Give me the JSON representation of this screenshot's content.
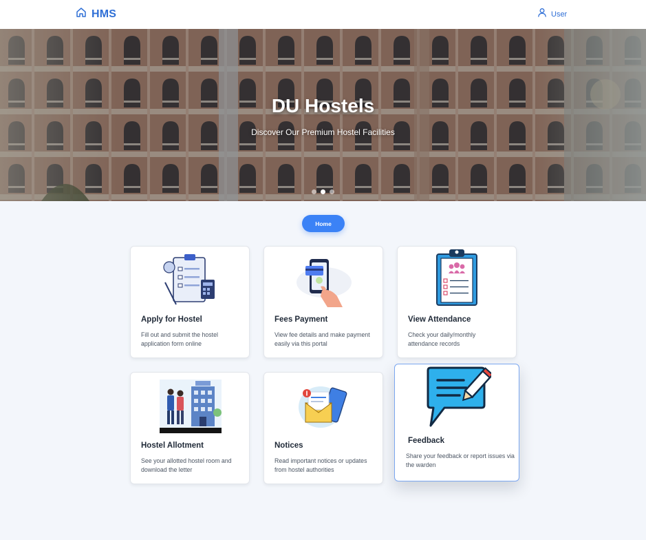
{
  "navbar": {
    "brand": "HMS",
    "brand_icon": "home-icon",
    "user_label": "User",
    "user_icon": "user-icon",
    "accent_color": "#2f6fd6"
  },
  "hero": {
    "title": "DU Hostels",
    "subtitle": "Discover Our Premium Hostel Facilities",
    "slide_count": 3,
    "active_slide": 2
  },
  "home_button": {
    "label": "Home",
    "color": "#3b82f6"
  },
  "cards": [
    {
      "title": "Apply for Hostel",
      "description": "Fill out and submit the hostel application form online",
      "icon": "application-form-icon"
    },
    {
      "title": "Fees Payment",
      "description": "View fee details and make payment easily via this portal",
      "icon": "mobile-payment-icon"
    },
    {
      "title": "View Attendance",
      "description": "Check your daily/monthly attendance records",
      "icon": "attendance-clipboard-icon"
    },
    {
      "title": "Hostel Allotment",
      "description": "See your allotted hostel room and download the letter",
      "icon": "hostel-building-icon"
    },
    {
      "title": "Notices",
      "description": "Read important notices or updates from hostel authorities",
      "icon": "notice-envelope-icon"
    },
    {
      "title": "Feedback",
      "description": "Share your feedback or report issues via the warden",
      "icon": "feedback-chat-icon"
    }
  ]
}
